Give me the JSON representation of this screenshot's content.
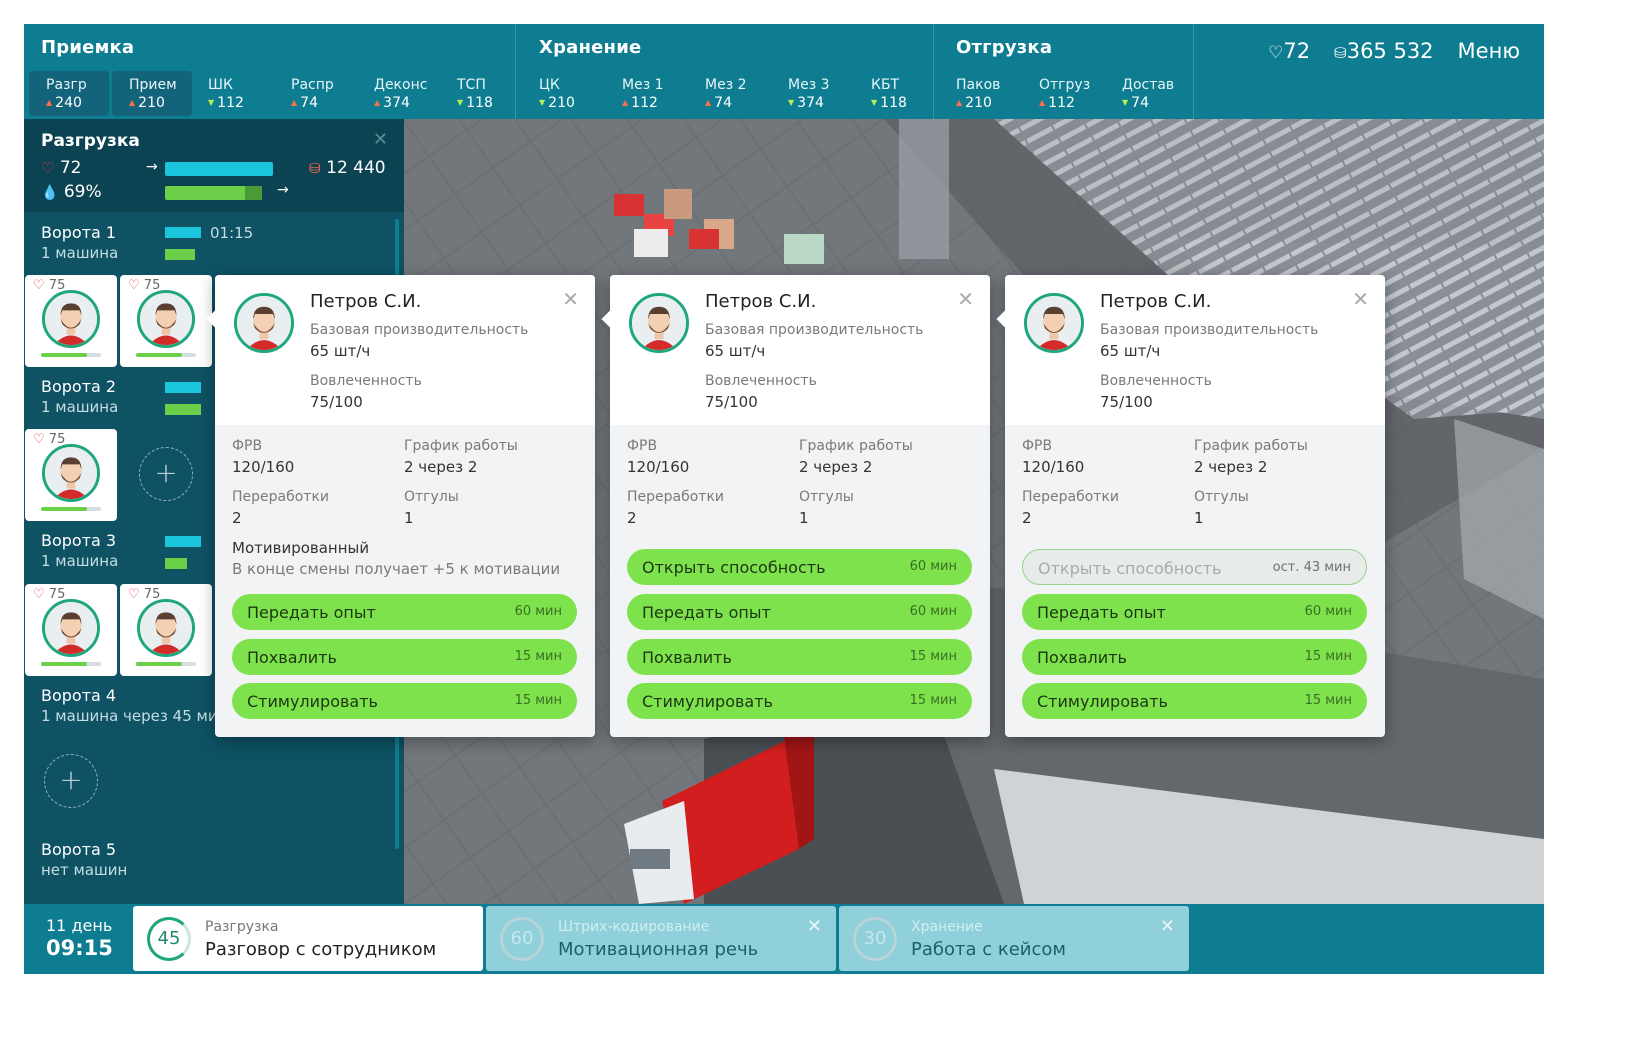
{
  "header": {
    "sections": [
      {
        "title": "Приемка",
        "tabs": [
          {
            "label": "Разгр",
            "value": "240",
            "trend": "up",
            "active": true
          },
          {
            "label": "Прием",
            "value": "210",
            "trend": "up",
            "active": true
          },
          {
            "label": "ШК",
            "value": "112",
            "trend": "down"
          },
          {
            "label": "Распр",
            "value": "74",
            "trend": "up"
          },
          {
            "label": "Деконс",
            "value": "374",
            "trend": "up"
          },
          {
            "label": "ТСП",
            "value": "118",
            "trend": "down"
          }
        ]
      },
      {
        "title": "Хранение",
        "tabs": [
          {
            "label": "ЦК",
            "value": "210",
            "trend": "down"
          },
          {
            "label": "Мез 1",
            "value": "112",
            "trend": "up"
          },
          {
            "label": "Мез 2",
            "value": "74",
            "trend": "up"
          },
          {
            "label": "Мез 3",
            "value": "374",
            "trend": "down"
          },
          {
            "label": "КБТ",
            "value": "118",
            "trend": "down"
          }
        ]
      },
      {
        "title": "Отгрузка",
        "tabs": [
          {
            "label": "Паков",
            "value": "210",
            "trend": "up"
          },
          {
            "label": "Отгруз",
            "value": "112",
            "trend": "up"
          },
          {
            "label": "Достав",
            "value": "74",
            "trend": "down"
          }
        ]
      }
    ],
    "hearts": "72",
    "coins": "365 532",
    "menu_label": "Меню"
  },
  "sidebar": {
    "title": "Разгрузка",
    "hearts": "72",
    "percent": "69%",
    "coins": "12 440",
    "gates": [
      {
        "name": "Ворота 1",
        "sub": "1 машина",
        "timer": "01:15"
      },
      {
        "name": "Ворота 2",
        "sub": "1 машина"
      },
      {
        "name": "Ворота 3",
        "sub": "1 машина"
      },
      {
        "name": "Ворота 4",
        "sub": "1 машина через 45 ми"
      },
      {
        "name": "Ворота 5",
        "sub": "нет машин"
      }
    ],
    "worker_score": "75"
  },
  "popups": [
    {
      "name": "Петров С.И.",
      "base_label": "Базовая производительность",
      "base_value": "65 шт/ч",
      "engage_label": "Вовлеченность",
      "engage_value": "75/100",
      "frv_label": "ФРВ",
      "frv_value": "120/160",
      "schedule_label": "График работы",
      "schedule_value": "2 через 2",
      "overtime_label": "Переработки",
      "overtime_value": "2",
      "dayoff_label": "Отгулы",
      "dayoff_value": "1",
      "trait_title": "Мотивированный",
      "trait_desc": "В конце смены получает +5 к мотивации",
      "buttons": [
        {
          "label": "Передать опыт",
          "time": "60 мин"
        },
        {
          "label": "Похвалить",
          "time": "15 мин"
        },
        {
          "label": "Стимулировать",
          "time": "15 мин"
        }
      ]
    },
    {
      "name": "Петров С.И.",
      "base_label": "Базовая производительность",
      "base_value": "65 шт/ч",
      "engage_label": "Вовлеченность",
      "engage_value": "75/100",
      "frv_label": "ФРВ",
      "frv_value": "120/160",
      "schedule_label": "График работы",
      "schedule_value": "2 через 2",
      "overtime_label": "Переработки",
      "overtime_value": "2",
      "dayoff_label": "Отгулы",
      "dayoff_value": "1",
      "buttons": [
        {
          "label": "Открыть способность",
          "time": "60 мин"
        },
        {
          "label": "Передать опыт",
          "time": "60 мин"
        },
        {
          "label": "Похвалить",
          "time": "15 мин"
        },
        {
          "label": "Стимулировать",
          "time": "15 мин"
        }
      ]
    },
    {
      "name": "Петров С.И.",
      "base_label": "Базовая производительность",
      "base_value": "65 шт/ч",
      "engage_label": "Вовлеченность",
      "engage_value": "75/100",
      "frv_label": "ФРВ",
      "frv_value": "120/160",
      "schedule_label": "График работы",
      "schedule_value": "2 через 2",
      "overtime_label": "Переработки",
      "overtime_value": "2",
      "dayoff_label": "Отгулы",
      "dayoff_value": "1",
      "buttons": [
        {
          "label": "Открыть способность",
          "time": "ост. 43 мин",
          "disabled": true
        },
        {
          "label": "Передать опыт",
          "time": "60 мин"
        },
        {
          "label": "Похвалить",
          "time": "15 мин"
        },
        {
          "label": "Стимулировать",
          "time": "15 мин"
        }
      ]
    }
  ],
  "footer": {
    "day": "11 день",
    "time": "09:15",
    "tasks": [
      {
        "number": "45",
        "category": "Разгрузка",
        "name": "Разговор с сотрудником"
      },
      {
        "number": "60",
        "category": "Штрих-кодирование",
        "name": "Мотивационная речь"
      },
      {
        "number": "30",
        "category": "Хранение",
        "name": "Работа с кейсом"
      }
    ]
  },
  "colors": {
    "teal": "#0e7d91",
    "sidebar": "#0e5264",
    "green_button": "#7ee24c",
    "heart": "#e8374a",
    "bar_cyan": "#1bc6dd",
    "bar_green": "#6bcf4a"
  }
}
